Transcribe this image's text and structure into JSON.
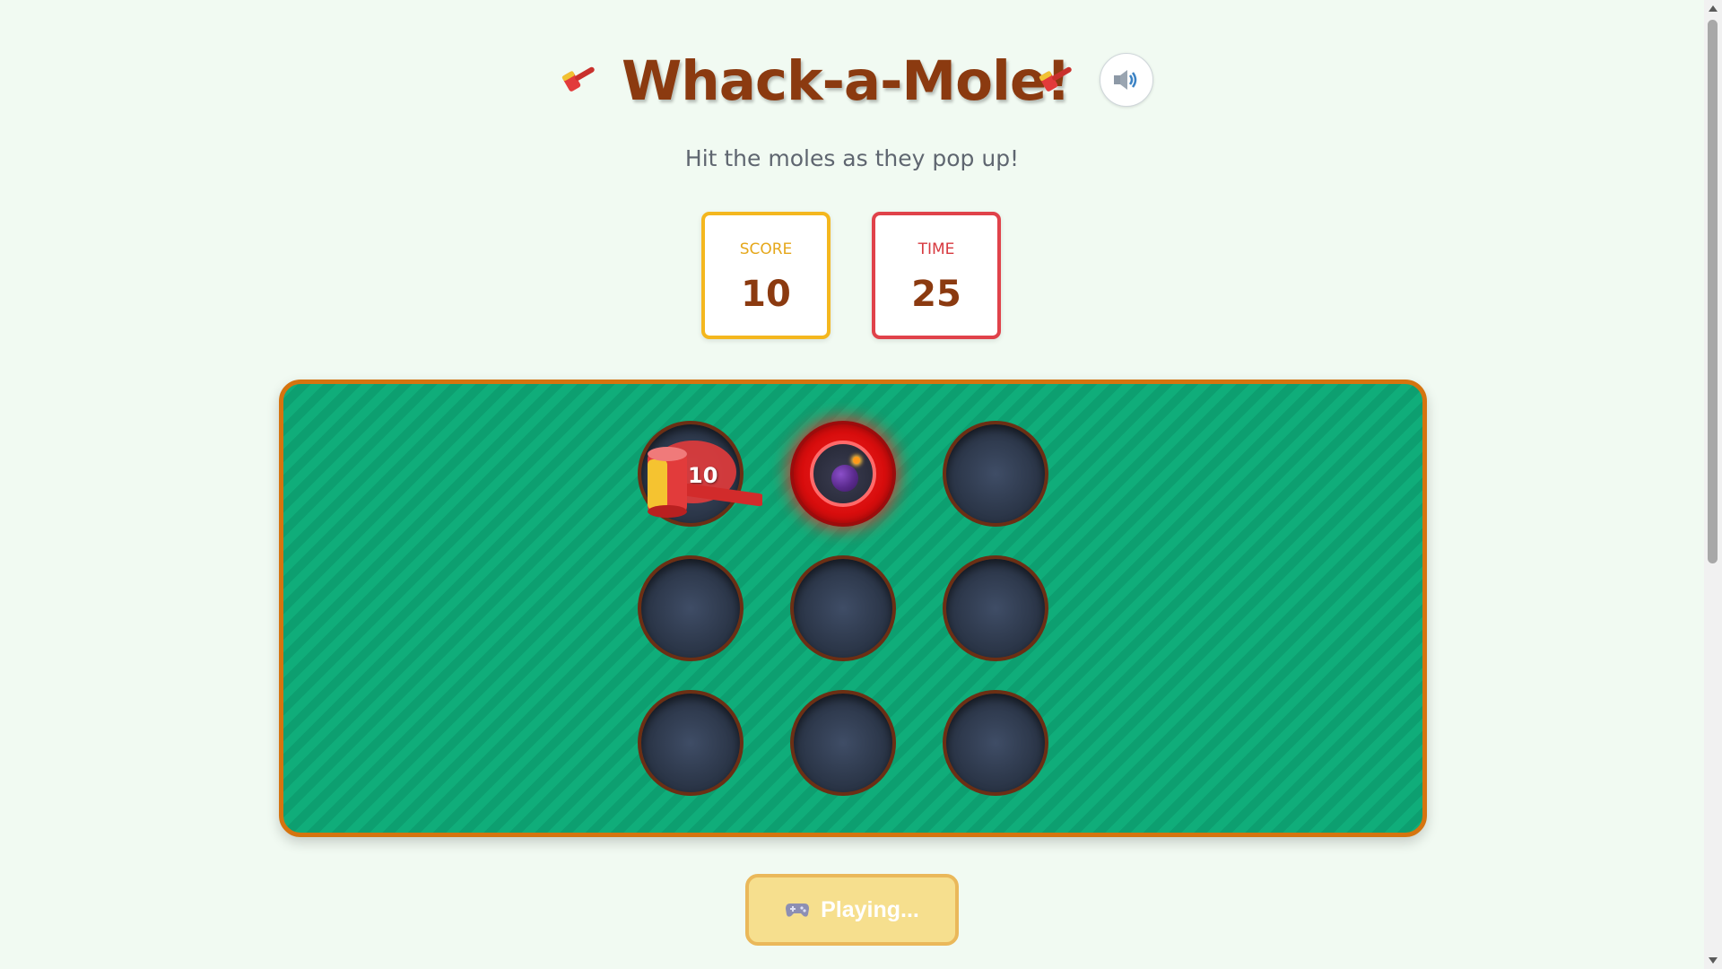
{
  "header": {
    "title": "Whack-a-Mole!",
    "left_icon": "hammer-icon",
    "right_icon": "hammer-icon",
    "sound_icon": "speaker-icon",
    "subtitle": "Hit the moles as they pop up!"
  },
  "stats": {
    "score": {
      "label": "SCORE",
      "value": "10",
      "color": "#f4b71e"
    },
    "time": {
      "label": "TIME",
      "value": "25",
      "color": "#e0424a"
    }
  },
  "board": {
    "holes": [
      {
        "state": "hit",
        "points": "10"
      },
      {
        "state": "bomb"
      },
      {
        "state": "empty"
      },
      {
        "state": "empty"
      },
      {
        "state": "empty"
      },
      {
        "state": "empty"
      },
      {
        "state": "empty"
      },
      {
        "state": "empty"
      },
      {
        "state": "empty"
      }
    ],
    "cursor_icon": "mallet-icon"
  },
  "play_button": {
    "label": "Playing...",
    "icon": "game-controller-icon"
  },
  "colors": {
    "title": "#8b3a10",
    "board_green": "#10ad7a",
    "board_border": "#d5740f",
    "background": "#f1faf2"
  }
}
